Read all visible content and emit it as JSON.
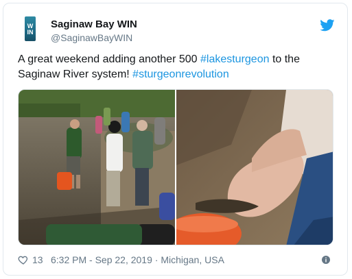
{
  "tweet": {
    "display_name": "Saginaw Bay WIN",
    "handle": "@SaginawBayWIN",
    "avatar_text": "W\nIN",
    "text_pre": "A great weekend adding another 500 ",
    "hashtag1": "#lakesturgeon",
    "text_mid": " to the Saginaw River system! ",
    "hashtag2": "#sturgeonrevolution",
    "likes": "13",
    "timestamp": "6:32 PM - Sep 22, 2019 · Michigan, USA"
  },
  "icons": {
    "platform": "twitter-bird-icon",
    "like": "heart-icon",
    "info": "info-icon"
  },
  "colors": {
    "hashtag": "#1b95e0",
    "bird": "#1da1f2",
    "text": "#14171a",
    "muted": "#657786"
  }
}
